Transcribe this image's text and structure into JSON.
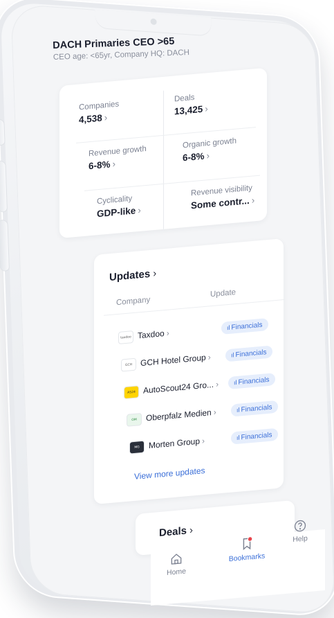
{
  "header": {
    "title": "DACH Primaries CEO >65",
    "subtitle": "CEO age: <65yr, Company HQ: DACH"
  },
  "stats": [
    {
      "label": "Companies",
      "value": "4,538"
    },
    {
      "label": "Deals",
      "value": "13,425"
    },
    {
      "label": "Revenue growth",
      "value": "6-8%"
    },
    {
      "label": "Organic growth",
      "value": "6-8%"
    },
    {
      "label": "Cyclicality",
      "value": "GDP-like"
    },
    {
      "label": "Revenue visibility",
      "value": "Some contr..."
    }
  ],
  "chevron": "›",
  "updates": {
    "title": "Updates",
    "col_company": "Company",
    "col_update": "Update",
    "rows": [
      {
        "company": "Taxdoo",
        "logo_text": "taxdoo",
        "update": "Financials"
      },
      {
        "company": "GCH Hotel Group",
        "logo_text": "GCH",
        "update": "Financials"
      },
      {
        "company": "AutoScout24 Gro...",
        "logo_text": "AS24",
        "update": "Financials"
      },
      {
        "company": "Oberpfalz Medien",
        "logo_text": "OM",
        "update": "Financials"
      },
      {
        "company": "Morten Group",
        "logo_text": "MG",
        "update": "Financials"
      }
    ],
    "view_more": "View more updates"
  },
  "deals": {
    "title": "Deals"
  },
  "tabbar": [
    {
      "label": "Home",
      "icon": "home-icon"
    },
    {
      "label": "Bookmarks",
      "icon": "bookmark-icon"
    },
    {
      "label": "Help",
      "icon": "help-icon"
    }
  ],
  "colors": {
    "accent": "#3b6fd8",
    "pill_bg": "#e6eefc",
    "badge": "#e8434a"
  }
}
